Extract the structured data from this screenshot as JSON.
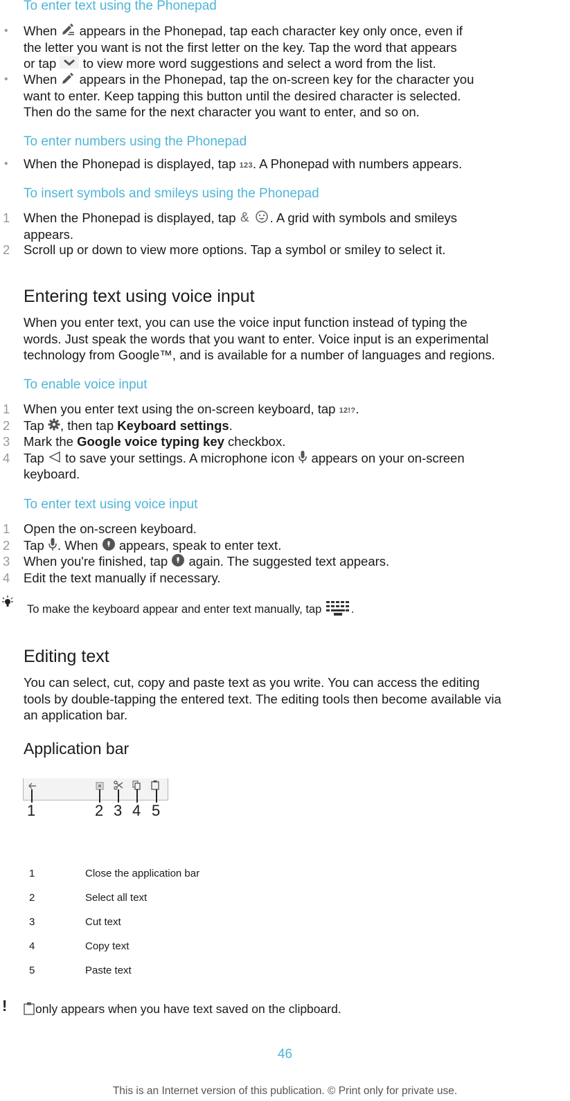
{
  "phonepad_text": {
    "heading": "To enter text using the Phonepad",
    "bullets": [
      {
        "lines": [
          [
            "When ",
            "{icon:pen-suggest}",
            " appears in the Phonepad, tap each character key only once, even if"
          ],
          [
            "the letter you want is not the first letter on the key. Tap the word that appears"
          ],
          [
            "or tap ",
            "{icon:chevron}",
            " to view more word suggestions and select a word from the list."
          ]
        ],
        "parts": {
          "l1a": "When ",
          "l1b": " appears in the Phonepad, tap each character key only once, even if",
          "l2": "the letter you want is not the first letter on the key. Tap the word that appears",
          "l3a": "or tap ",
          "l3b": " to view more word suggestions and select a word from the list."
        }
      },
      {
        "parts": {
          "l1a": "When ",
          "l1b": " appears in the Phonepad, tap the on-screen key for the character you",
          "l2": "want to enter. Keep tapping this button until the desired character is selected.",
          "l3": "Then do the same for the next character you want to enter, and so on."
        }
      }
    ]
  },
  "phonepad_numbers": {
    "heading": "To enter numbers using the Phonepad",
    "bullet_a": "When the Phonepad is displayed, tap ",
    "key_label": "123",
    "bullet_b": ". A Phonepad with numbers appears."
  },
  "phonepad_symbols": {
    "heading": "To insert symbols and smileys using the Phonepad",
    "steps": [
      {
        "num": "1",
        "a": "When the Phonepad is displayed, tap ",
        "b": ". A grid with symbols and smileys",
        "c": "appears."
      },
      {
        "num": "2",
        "text": "Scroll up or down to view more options. Tap a symbol or smiley to select it."
      }
    ]
  },
  "voice_section": {
    "title": "Entering text using voice input",
    "intro": [
      "When you enter text, you can use the voice input function instead of typing the",
      "words. Just speak the words that you want to enter. Voice input is an experimental",
      "technology from Google™, and is available for a number of languages and regions."
    ]
  },
  "enable_voice": {
    "heading": "To enable voice input",
    "steps": [
      {
        "num": "1",
        "a": "When you enter text using the on-screen keyboard, tap ",
        "key": "12!?",
        "b": "."
      },
      {
        "num": "2",
        "a": "Tap ",
        "b": ", then tap ",
        "bold": "Keyboard settings",
        "c": "."
      },
      {
        "num": "3",
        "a": "Mark the ",
        "bold": "Google voice typing key",
        "b": " checkbox."
      },
      {
        "num": "4",
        "a": "Tap ",
        "b": " to save your settings. A microphone icon ",
        "c": " appears on your on-screen",
        "d": "keyboard."
      }
    ]
  },
  "enter_voice": {
    "heading": "To enter text using voice input",
    "steps": [
      {
        "num": "1",
        "text": "Open the on-screen keyboard."
      },
      {
        "num": "2",
        "a": "Tap ",
        "b": ". When ",
        "c": " appears, speak to enter text."
      },
      {
        "num": "3",
        "a": "When you're finished, tap ",
        "b": " again. The suggested text appears."
      },
      {
        "num": "4",
        "text": "Edit the text manually if necessary."
      }
    ],
    "tip": {
      "a": "To make the keyboard appear and enter text manually, tap ",
      "b": "."
    }
  },
  "editing": {
    "title": "Editing text",
    "intro": [
      "You can select, cut, copy and paste text as you write. You can access the editing",
      "tools by double-tapping the entered text. The editing tools then become available via",
      "an application bar."
    ],
    "app_bar_heading": "Application bar",
    "callout_numbers": [
      "1",
      "2",
      "3",
      "4",
      "5"
    ],
    "table": [
      {
        "num": "1",
        "label": "Close the application bar"
      },
      {
        "num": "2",
        "label": "Select all text"
      },
      {
        "num": "3",
        "label": "Cut text"
      },
      {
        "num": "4",
        "label": "Copy text"
      },
      {
        "num": "5",
        "label": "Paste text"
      }
    ],
    "note": "only appears when you have text saved on the clipboard."
  },
  "footer": {
    "page_number": "46",
    "notice": "This is an Internet version of this publication. © Print only for private use."
  },
  "colors": {
    "accent": "#4fb5d6",
    "text": "#1a1a1a",
    "muted": "#9a9a9a"
  }
}
